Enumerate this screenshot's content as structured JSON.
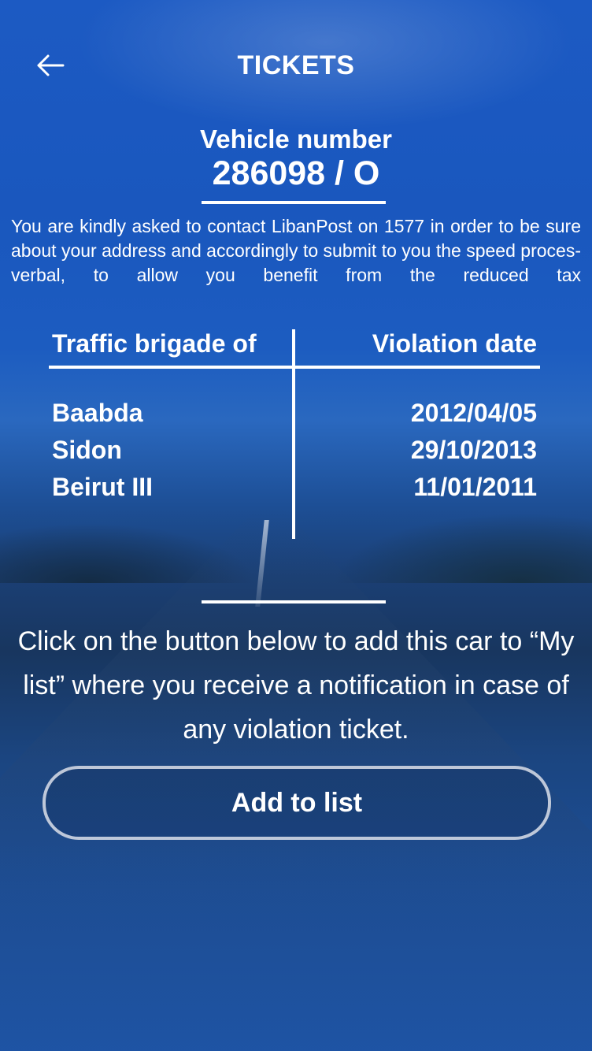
{
  "header": {
    "title": "TICKETS",
    "back_icon": "arrow-left-icon"
  },
  "vehicle": {
    "label": "Vehicle number",
    "number": "286098 / O"
  },
  "notice": "You are kindly asked to contact LibanPost on 1577 in order to be sure about your address and accordingly to submit to you the speed proces-verbal, to allow you benefit from the reduced tax",
  "tickets_table": {
    "columns": [
      "Traffic brigade of",
      "Violation date"
    ],
    "rows": [
      {
        "brigade": "Baabda",
        "date": "2012/04/05"
      },
      {
        "brigade": "Sidon",
        "date": "29/10/2013"
      },
      {
        "brigade": "Beirut III",
        "date": "11/01/2011"
      }
    ]
  },
  "info_text": "Click on the button below to add this car to “My list” where you receive a notification in case of any violation ticket.",
  "add_button": {
    "label": "Add to list"
  },
  "colors": {
    "background": "#1d56b8",
    "text": "#ffffff",
    "button_border": "#dce1eb"
  }
}
